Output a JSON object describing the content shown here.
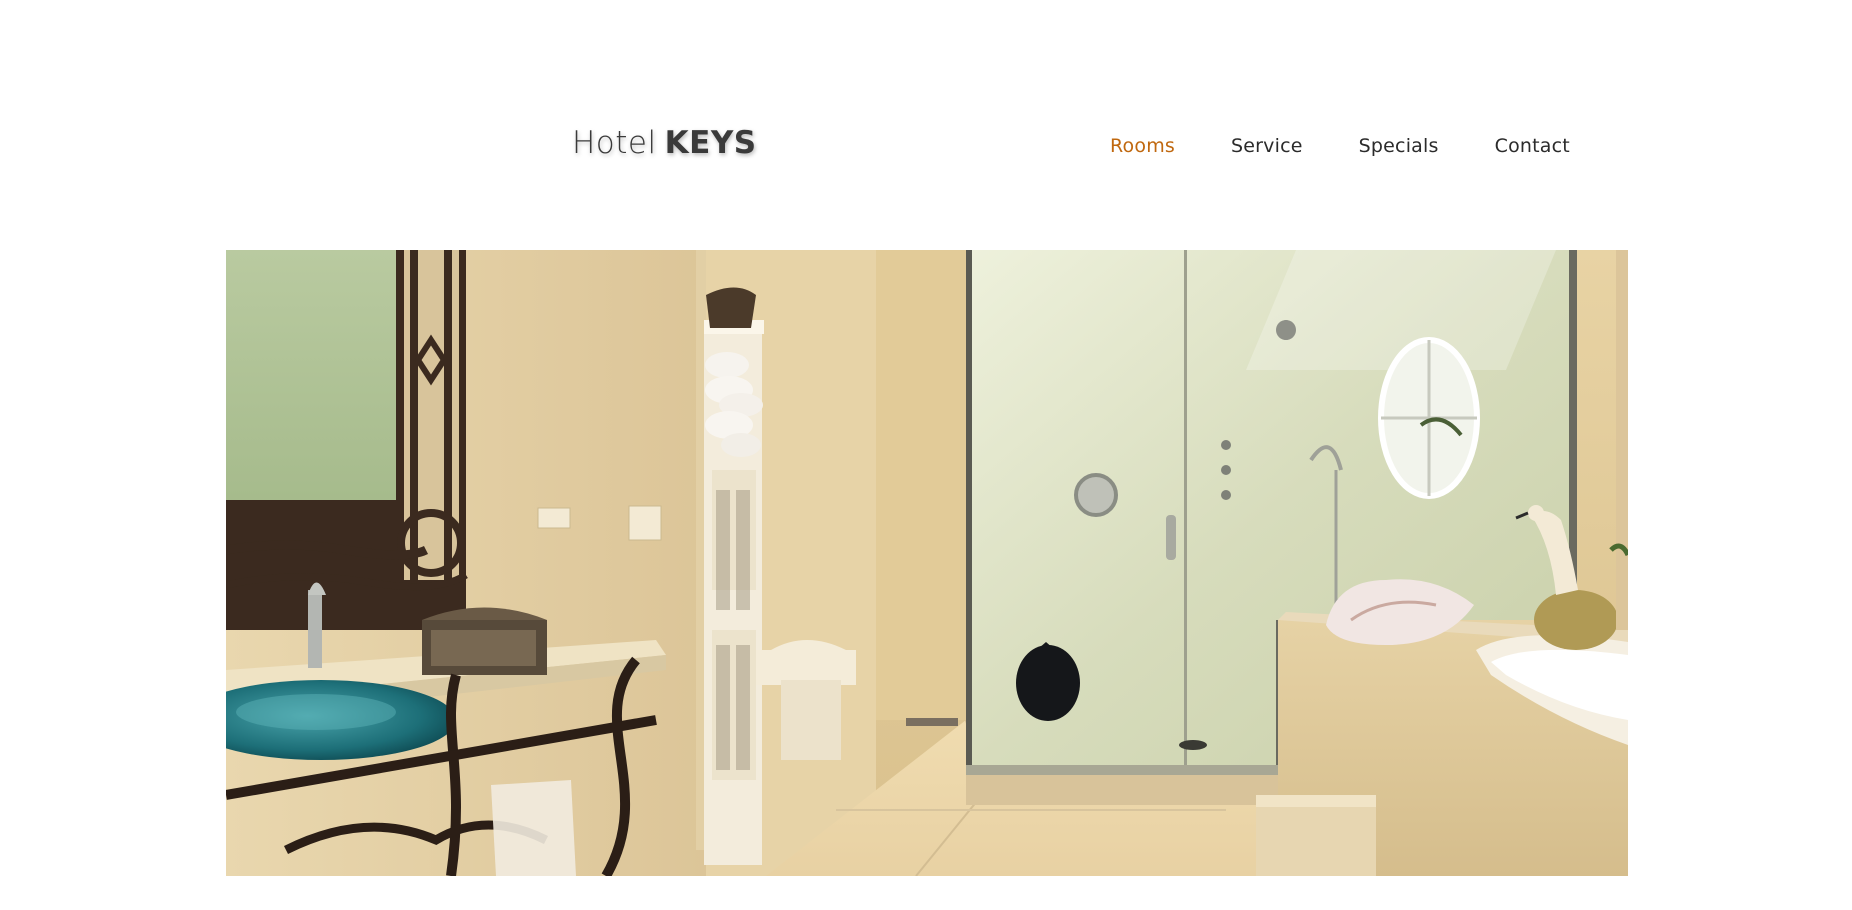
{
  "logo": {
    "light": "Hotel",
    "bold": "KEYS"
  },
  "nav": {
    "items": [
      {
        "label": "Rooms",
        "active": true
      },
      {
        "label": "Service",
        "active": false
      },
      {
        "label": "Specials",
        "active": false
      },
      {
        "label": "Contact",
        "active": false
      }
    ]
  },
  "colors": {
    "accent": "#c0680f",
    "text": "#2b2b2b",
    "background": "#ffffff"
  },
  "hero": {
    "subject": "bathroom-photo"
  }
}
